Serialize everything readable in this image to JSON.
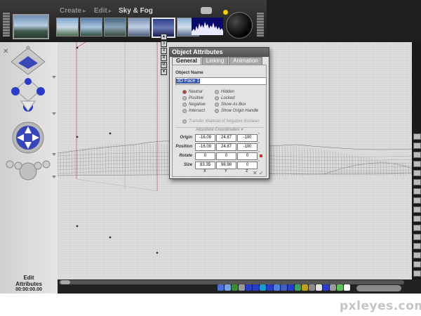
{
  "top_menu": {
    "create": "Create",
    "edit": "Edit",
    "current": "Sky & Fog"
  },
  "presets": [
    {
      "name": "sky-preset-1",
      "colors": [
        "#7fa8d0",
        "#c9d8e6",
        "#4a6a4a"
      ]
    },
    {
      "name": "sky-preset-2",
      "colors": [
        "#5a7ea8",
        "#a8c4e0",
        "#2f4f3f"
      ]
    },
    {
      "name": "sky-preset-3",
      "colors": [
        "#46647e",
        "#8aa4b8",
        "#3a4a3a"
      ]
    },
    {
      "name": "sky-preset-4",
      "colors": [
        "#7890b8",
        "#c0cfe2",
        "#506080"
      ]
    },
    {
      "name": "sky-preset-5",
      "colors": [
        "#2c3c8c",
        "#6a7ab8",
        "#1a1a4a"
      ]
    },
    {
      "name": "sky-preset-6",
      "colors": [
        "#8ab0d4",
        "#d4e0ec",
        "#5a7090"
      ]
    }
  ],
  "dialog": {
    "title": "Object Attributes",
    "tabs": [
      "General",
      "Linking",
      "Animation"
    ],
    "object_name_label": "Object Name",
    "object_name_value": "3D Face 1",
    "options_left": [
      "Neutral",
      "Positive",
      "Negative",
      "Intersect"
    ],
    "options_right": [
      "Hidden",
      "Locked",
      "Show As Box",
      "Show Origin Handle"
    ],
    "transfer_label": "Transfer Material of Negative Boolean",
    "coords_title": "Absolute Coordinates",
    "rows": [
      {
        "label": "Origin",
        "values": [
          "-16.09",
          "24.87",
          "-100"
        ]
      },
      {
        "label": "Position",
        "values": [
          "-16.09",
          "24.87",
          "-100"
        ]
      },
      {
        "label": "Rotate",
        "values": [
          "0",
          "0",
          "0"
        ]
      },
      {
        "label": "Size",
        "values": [
          "83.35",
          "96.98",
          "0"
        ]
      }
    ],
    "axes": [
      "X",
      "Y",
      "Z"
    ],
    "footer_close": "✕",
    "footer_ok": "✓"
  },
  "left_panel": {
    "mode_line1": "Edit",
    "mode_line2": "Attributes",
    "timecode": "00:00:00.00"
  },
  "watermark": "pxleyes.com",
  "colors": {
    "accent_blue": "#2a3cc8",
    "selection": "#3a56a8",
    "radio_on": "#c0392b"
  }
}
